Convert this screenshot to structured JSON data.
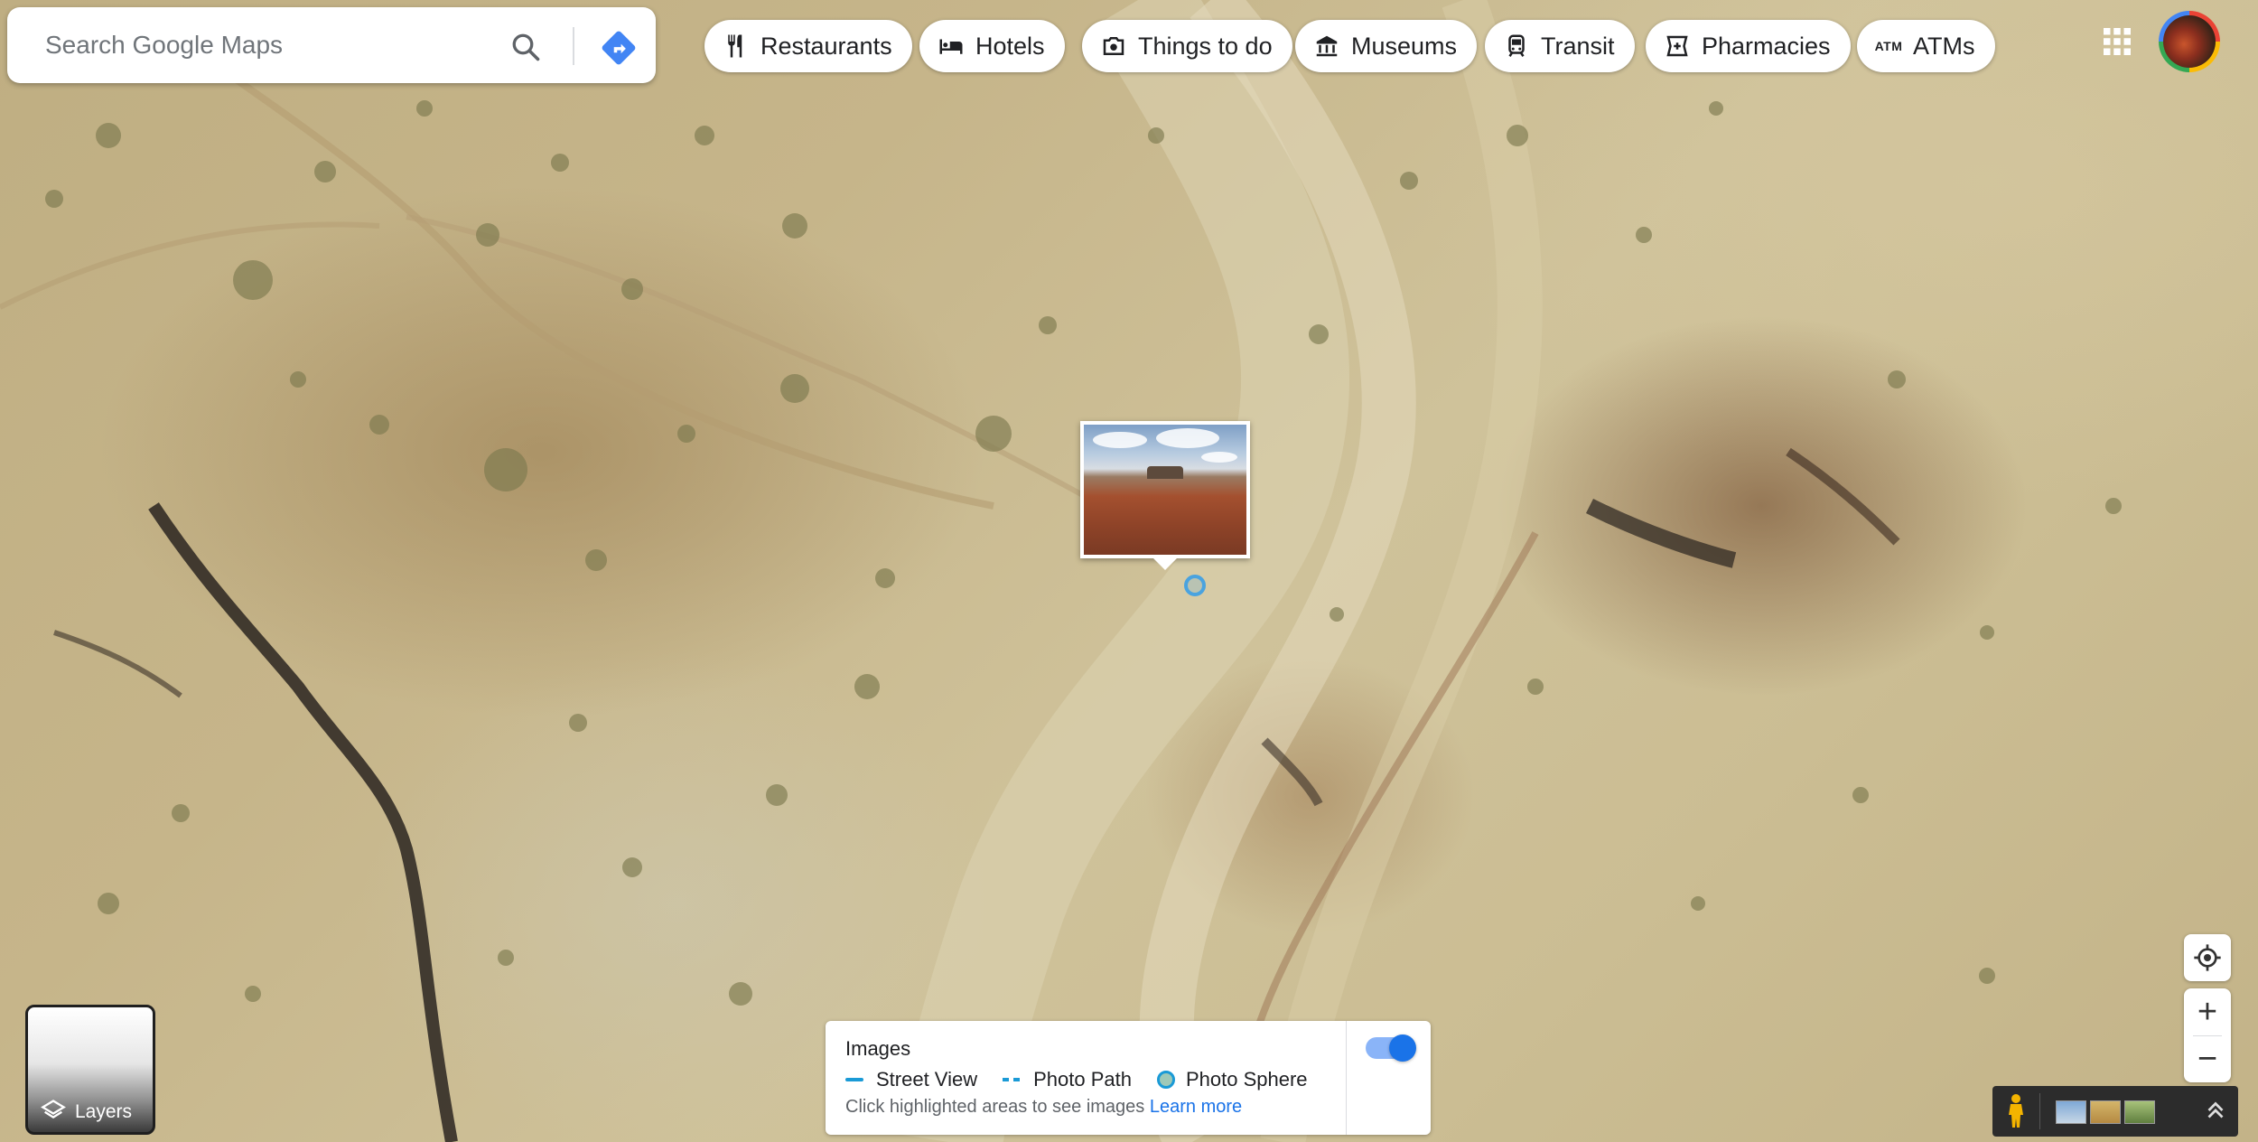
{
  "search": {
    "placeholder": "Search Google Maps"
  },
  "chips": [
    {
      "label": "Restaurants",
      "icon": "restaurant-icon"
    },
    {
      "label": "Hotels",
      "icon": "hotel-icon"
    },
    {
      "label": "Things to do",
      "icon": "camera-icon"
    },
    {
      "label": "Museums",
      "icon": "museum-icon"
    },
    {
      "label": "Transit",
      "icon": "transit-icon"
    },
    {
      "label": "Pharmacies",
      "icon": "pharmacy-icon"
    },
    {
      "label": "ATMs",
      "icon": "atm-icon",
      "icon_text": "ATM"
    }
  ],
  "layers": {
    "label": "Layers"
  },
  "images_panel": {
    "title": "Images",
    "legend": {
      "street_view": "Street View",
      "photo_path": "Photo Path",
      "photo_sphere": "Photo Sphere"
    },
    "hint": "Click highlighted areas to see images",
    "learn_more": "Learn more",
    "toggle_on": true
  },
  "zoom": {
    "in": "+",
    "out": "−"
  },
  "colors": {
    "accent_blue": "#1a73e8",
    "street_view_blue": "#1a9ad6",
    "directions_blue": "#4285f4"
  }
}
